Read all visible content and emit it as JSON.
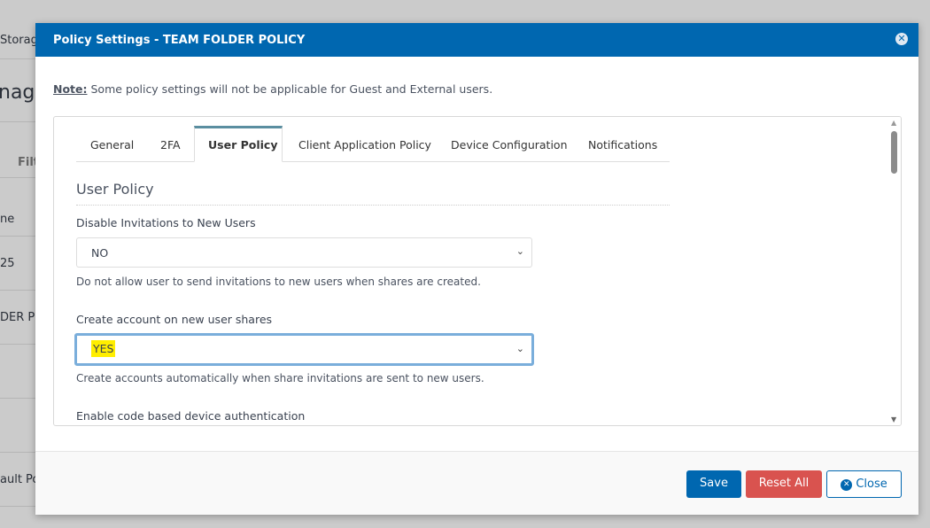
{
  "background": {
    "breadcrumb_fragment": "Storag",
    "title_fragment": "nage",
    "filter_fragment": "Filt",
    "column_fragment": "ne",
    "rows": [
      "25",
      "DER P",
      "ault Po"
    ]
  },
  "modal": {
    "title": "Policy Settings - TEAM FOLDER POLICY",
    "note_label": "Note:",
    "note_text": " Some policy settings will not be applicable for Guest and External users.",
    "tabs": [
      "General",
      "2FA",
      "User Policy",
      "Client Application Policy",
      "Device Configuration",
      "Notifications"
    ],
    "active_tab": "User Policy",
    "section_title": "User Policy",
    "fields": [
      {
        "label": "Disable Invitations to New Users",
        "value": "NO",
        "help": "Do not allow user to send invitations to new users when shares are created."
      },
      {
        "label": "Create account on new user shares",
        "value": "YES",
        "help": "Create accounts automatically when share invitations are sent to new users."
      },
      {
        "label": "Enable code based device authentication"
      }
    ],
    "buttons": {
      "save": "Save",
      "reset": "Reset All",
      "close": "Close"
    },
    "colors": {
      "header": "#0067b0",
      "reset": "#d9534f",
      "highlight": "#ffee00"
    }
  }
}
